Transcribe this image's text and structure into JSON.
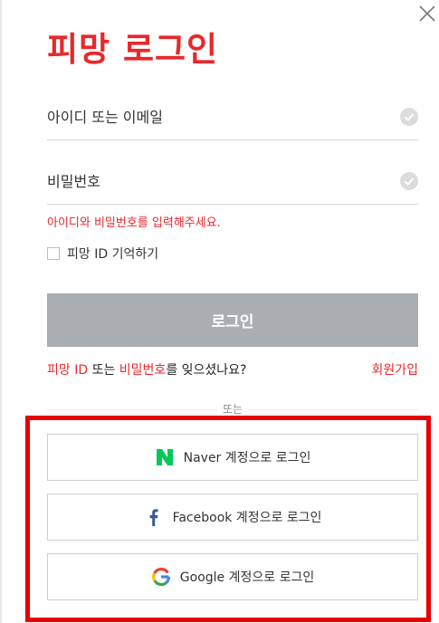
{
  "header": {
    "title": "피망 로그인"
  },
  "form": {
    "id_placeholder": "아이디 또는 이메일",
    "id_value": "",
    "password_placeholder": "비밀번호",
    "password_value": "",
    "error_message": "아이디와 비밀번호를 입력해주세요.",
    "remember_label": "피망 ID 기억하기",
    "remember_checked": false,
    "login_label": "로그인"
  },
  "links": {
    "forgot_id": "피망 ID",
    "forgot_or": " 또는 ",
    "forgot_password": "비밀번호",
    "forgot_suffix": "를 잊으셨나요?",
    "signup": "회원가입"
  },
  "divider": {
    "label": "또는"
  },
  "social": {
    "naver_label": "Naver 계정으로 로그인",
    "facebook_label": "Facebook 계정으로 로그인",
    "google_label": "Google 계정으로 로그인"
  },
  "icons": {
    "close": "close-icon",
    "check": "check-circle-icon",
    "naver": "naver-logo-icon",
    "facebook": "facebook-logo-icon",
    "google": "google-logo-icon"
  },
  "colors": {
    "brand_red": "#e8282b",
    "login_button": "#a9aeb3",
    "highlight_border": "#e60000",
    "naver_green": "#03c75a",
    "facebook_blue": "#3b5998"
  }
}
